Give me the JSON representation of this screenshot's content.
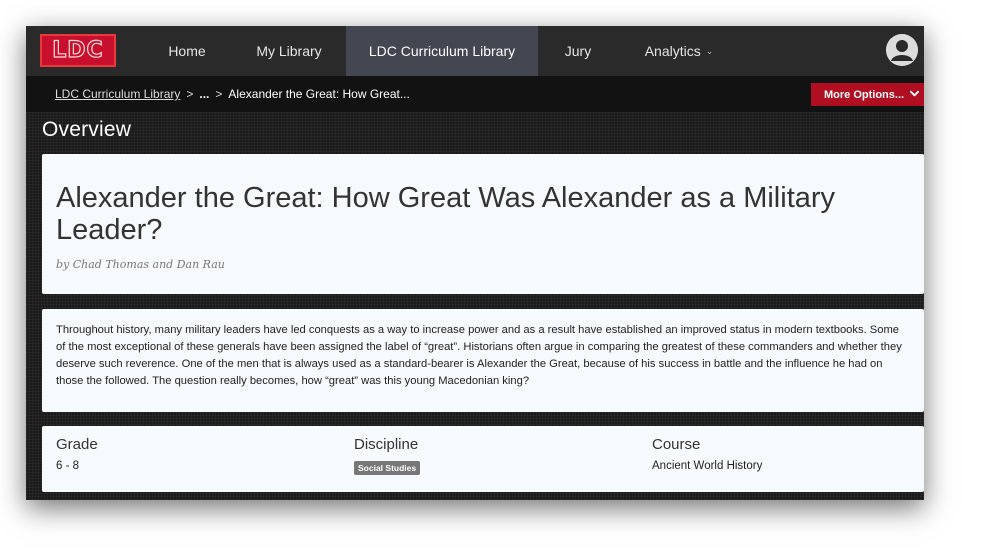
{
  "brand": {
    "logo_text": "LDC",
    "accent": "#c8102e"
  },
  "nav": {
    "items": [
      {
        "label": "Home"
      },
      {
        "label": "My Library"
      },
      {
        "label": "LDC Curriculum Library",
        "active": true
      },
      {
        "label": "Jury"
      },
      {
        "label": "Analytics"
      }
    ],
    "analytics_caret": "⌄",
    "user_icon": "user-avatar-icon"
  },
  "breadcrumb": {
    "root": "LDC Curriculum Library",
    "separator": ">",
    "ellipsis": "...",
    "current": "Alexander the Great: How Great..."
  },
  "more_options": {
    "label": "More Options...",
    "icon": "chevron-down-icon",
    "color": "#b00f22"
  },
  "section_title": "Overview",
  "module": {
    "title": "Alexander the Great: How Great Was Alexander as a Military Leader?",
    "byline": "by Chad Thomas and Dan Rau",
    "description": "Throughout history, many military leaders have led conquests as a way to increase power and as a result have established an improved status in modern textbooks. Some of the most exceptional of these generals have been assigned the label of “great”. Historians often argue in comparing the greatest of these commanders and whether they deserve such reverence. One of the men that is always used as a standard-bearer is Alexander the Great, because of his success in battle and the influence he had on those the followed. The question really becomes, how “great” was this young Macedonian king?"
  },
  "details": {
    "grade_label": "Grade",
    "grade_value": "6 - 8",
    "discipline_label": "Discipline",
    "discipline_value": "Social Studies",
    "course_label": "Course",
    "course_value": "Ancient World History"
  }
}
